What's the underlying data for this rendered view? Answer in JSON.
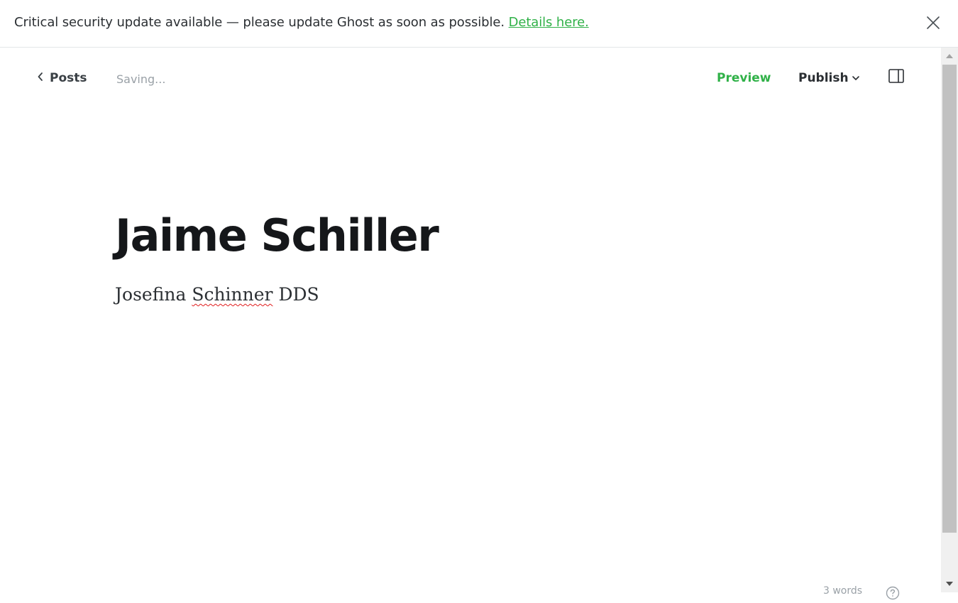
{
  "banner": {
    "message": "Critical security update available — please update Ghost as soon as possible. ",
    "link_text": "Details here.",
    "close_icon": "close-icon"
  },
  "toolbar": {
    "back_label": "Posts",
    "back_icon": "chevron-left-icon",
    "status": "Saving...",
    "preview_label": "Preview",
    "publish_label": "Publish",
    "publish_icon": "chevron-down-icon",
    "sidebar_icon": "sidebar-toggle-icon"
  },
  "post": {
    "title": "Jaime Schiller",
    "body_before": "Josefina ",
    "body_misspelled": "Schinner",
    "body_after": " DDS"
  },
  "footer": {
    "word_count": "3 words",
    "help_icon": "help-icon"
  },
  "colors": {
    "accent": "#30b148",
    "text": "#15171a",
    "muted": "#9aa1a7"
  }
}
